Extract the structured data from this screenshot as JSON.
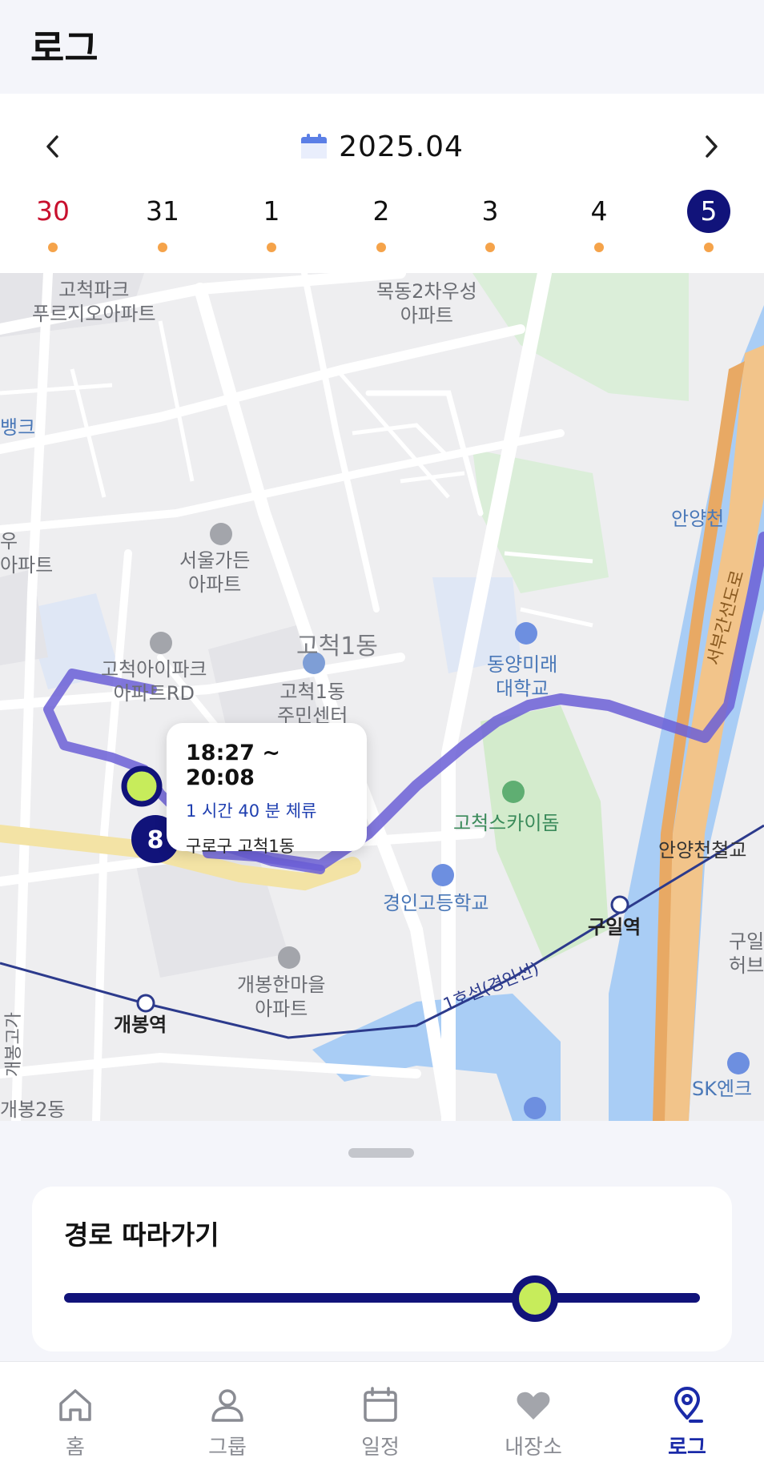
{
  "header": {
    "title": "로그"
  },
  "month_nav": {
    "prev_icon": "chevron-left-icon",
    "next_icon": "chevron-right-icon",
    "month_label": "2025.04",
    "calendar_icon": "calendar-icon"
  },
  "days": [
    {
      "label": "30",
      "type": "sunday",
      "has_log": true
    },
    {
      "label": "31",
      "type": "normal",
      "has_log": true
    },
    {
      "label": "1",
      "type": "normal",
      "has_log": true
    },
    {
      "label": "2",
      "type": "normal",
      "has_log": true
    },
    {
      "label": "3",
      "type": "normal",
      "has_log": true
    },
    {
      "label": "4",
      "type": "normal",
      "has_log": true
    },
    {
      "label": "5",
      "type": "selected",
      "has_log": true
    }
  ],
  "map": {
    "labels": {
      "gocheok_park": "고척파크\n푸르지오아파트",
      "mokdong": "목동2차우성\n아파트",
      "bank": "뱅크",
      "ui_apt": "우\n아파트",
      "seoul_garden": "서울가든\n아파트",
      "anyangcheon": "안양천",
      "gocheok_ipark": "고척아이파크\n아파트RD",
      "gocheok1": "고척1동",
      "gocheok1_center": "고척1동\n주민센터",
      "dongyang": "동양미래\n대학교",
      "seobu": "서부간선도로",
      "skydome": "고척스카이돔",
      "anyang_bridge": "안양천철교",
      "kyungin_high": "경인고등학교",
      "guil_station": "구일역",
      "guil_hub": "구일\n허브",
      "gaebong_hanmaeul": "개봉한마을\n아파트",
      "line1": "1호선(경인선)",
      "gaebong_station": "개봉역",
      "gaebong_goga": "개봉고가",
      "gaebong2": "개봉2동",
      "sk": "SK엔크",
      "cluster_partial": "고\n주민센터 RD"
    },
    "cluster_count": "8",
    "tooltip": {
      "time": "18:27 ~ 20:08",
      "stay": "1 시간 40 분 체류",
      "place": "구로구 고척1동"
    },
    "route_color": "#6b5fd6",
    "marker_color": "#c7ec5b"
  },
  "follow": {
    "title": "경로 따라가기",
    "progress": 0.74
  },
  "tabs": [
    {
      "label": "홈",
      "icon": "home-icon",
      "active": false
    },
    {
      "label": "그룹",
      "icon": "person-icon",
      "active": false
    },
    {
      "label": "일정",
      "icon": "calendar-icon",
      "active": false
    },
    {
      "label": "내장소",
      "icon": "heart-icon",
      "active": false
    },
    {
      "label": "로그",
      "icon": "location-pin-icon",
      "active": true
    }
  ],
  "colors": {
    "primary": "#11137a",
    "accent_dot": "#f5a34a",
    "sunday": "#c8102e",
    "active_tab": "#1a2aa8"
  }
}
